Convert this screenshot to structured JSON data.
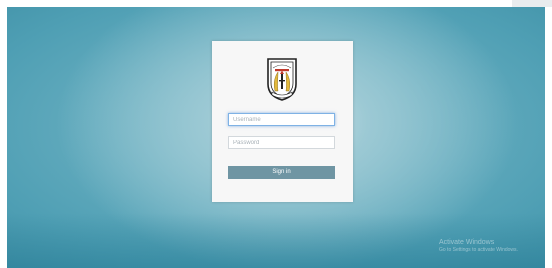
{
  "login": {
    "logo_icon": "school-crest-logo",
    "username_placeholder": "Username",
    "password_placeholder": "Password",
    "signin_label": "Sign in"
  },
  "watermark": {
    "title": "Activate Windows",
    "subtitle": "Go to Settings to activate Windows."
  },
  "colors": {
    "background": "#4f9fb4",
    "card": "#f7f7f7",
    "signin_button": "#6f95a3",
    "focus_border": "#7fb2e5"
  }
}
